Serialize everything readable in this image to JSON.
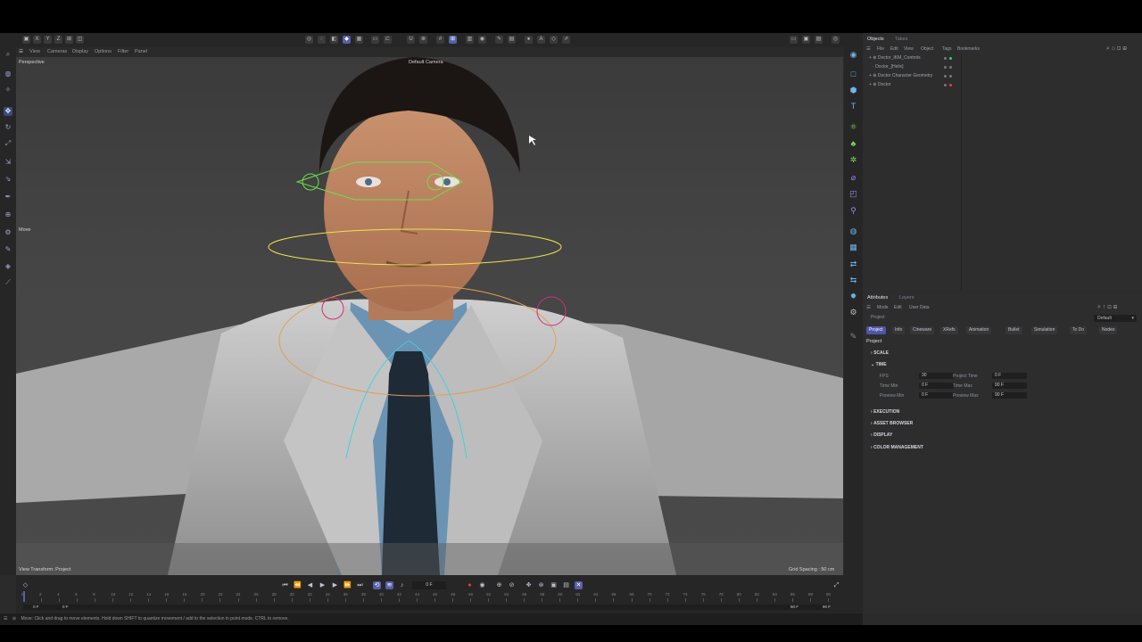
{
  "viewport": {
    "view_name": "Perspective",
    "camera": "Default Camera",
    "menu": [
      "View",
      "Cameras",
      "Display",
      "Options",
      "Filter",
      "Panel"
    ],
    "tool_hint": "Move",
    "view_transform": "View Transform: Project",
    "grid_spacing": "Grid Spacing : 50 cm"
  },
  "object_manager": {
    "tabs": [
      "Objects",
      "Takes"
    ],
    "menu": [
      "File",
      "Edit",
      "View",
      "Object",
      "Tags",
      "Bookmarks"
    ],
    "tree": [
      "Doctor_IKM_Controls",
      "Doctor_[Helix]",
      "Doctor Character Geometry",
      "Doctor"
    ]
  },
  "attributes": {
    "tabs": [
      "Attributes",
      "Layers"
    ],
    "menu": [
      "Mode",
      "Edit",
      "User Data"
    ],
    "breadcrumb": "Project",
    "preset": "Default",
    "chips": [
      "Project",
      "Info",
      "Cineware",
      "XRefs",
      "Animation",
      "Bullet",
      "Simulation",
      "To Do",
      "Nodes"
    ],
    "title": "Project",
    "sections": {
      "scale": "SCALE",
      "time": "TIME",
      "execution": "EXECUTION",
      "asset_browser": "ASSET BROWSER",
      "display": "DISPLAY",
      "color_management": "COLOR MANAGEMENT"
    },
    "fields": {
      "fps_label": "FPS",
      "fps": "30",
      "project_time_label": "Project Time",
      "project_time": "0 F",
      "time_min_label": "Time Min",
      "time_min": "0 F",
      "time_max_label": "Time Max",
      "time_max": "90 F",
      "preview_min_label": "Preview Min",
      "preview_min": "0 F",
      "preview_max_label": "Preview Max",
      "preview_max": "90 F"
    }
  },
  "timeline": {
    "current_frame": "0 F",
    "ruler": [
      "0",
      "2",
      "4",
      "6",
      "8",
      "10",
      "12",
      "14",
      "16",
      "18",
      "20",
      "22",
      "24",
      "26",
      "28",
      "30",
      "32",
      "34",
      "36",
      "38",
      "40",
      "42",
      "44",
      "46",
      "48",
      "50",
      "52",
      "54",
      "56",
      "58",
      "60",
      "62",
      "64",
      "66",
      "68",
      "70",
      "72",
      "74",
      "76",
      "78",
      "80",
      "82",
      "84",
      "86",
      "88",
      "90"
    ],
    "start_a": "0 F",
    "start_b": "0 F",
    "end_a": "90 F",
    "end_b": "90 F"
  },
  "status": "Move: Click and drag to move elements. Hold down SHIFT to quantize movement / add to the selection in point mode, CTRL to remove."
}
